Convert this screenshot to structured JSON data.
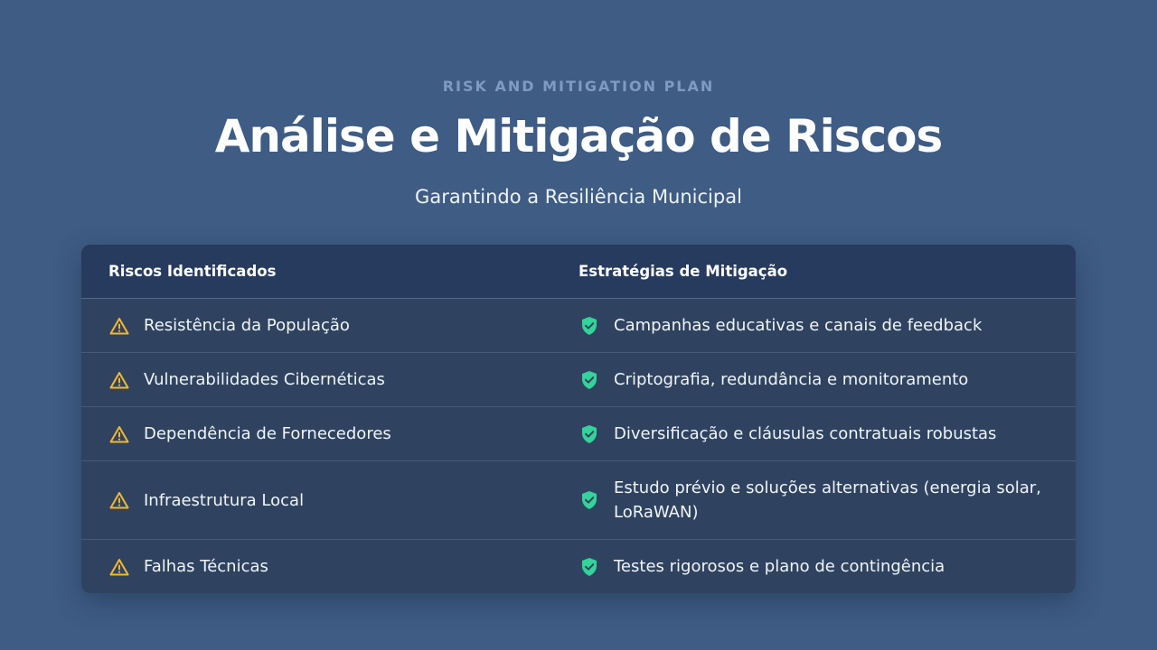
{
  "header": {
    "eyebrow": "RISK AND MITIGATION PLAN",
    "title": "Análise e Mitigação de Riscos",
    "subtitle": "Garantindo a Resiliência Municipal"
  },
  "table": {
    "columns": [
      "Riscos Identificados",
      "Estratégias de Mitigação"
    ],
    "rows": [
      {
        "risk": "Resistência da População",
        "mitigation": "Campanhas educativas e canais de feedback"
      },
      {
        "risk": "Vulnerabilidades Cibernéticas",
        "mitigation": "Criptografia, redundância e monitoramento"
      },
      {
        "risk": "Dependência de Fornecedores",
        "mitigation": "Diversificação e cláusulas contratuais robustas"
      },
      {
        "risk": "Infraestrutura Local",
        "mitigation": "Estudo prévio e soluções alternativas (energia solar, LoRaWAN)"
      },
      {
        "risk": "Falhas Técnicas",
        "mitigation": "Testes rigorosos e plano de contingência"
      }
    ]
  },
  "icons": {
    "risk_icon": "warning-triangle-icon",
    "mitigation_icon": "shield-check-icon"
  },
  "colors": {
    "background": "#3e5c84",
    "card": "#2f4360",
    "header_row": "#273b5f",
    "warning": "#f4b731",
    "shield": "#34d399",
    "eyebrow": "#7f9bc4"
  }
}
